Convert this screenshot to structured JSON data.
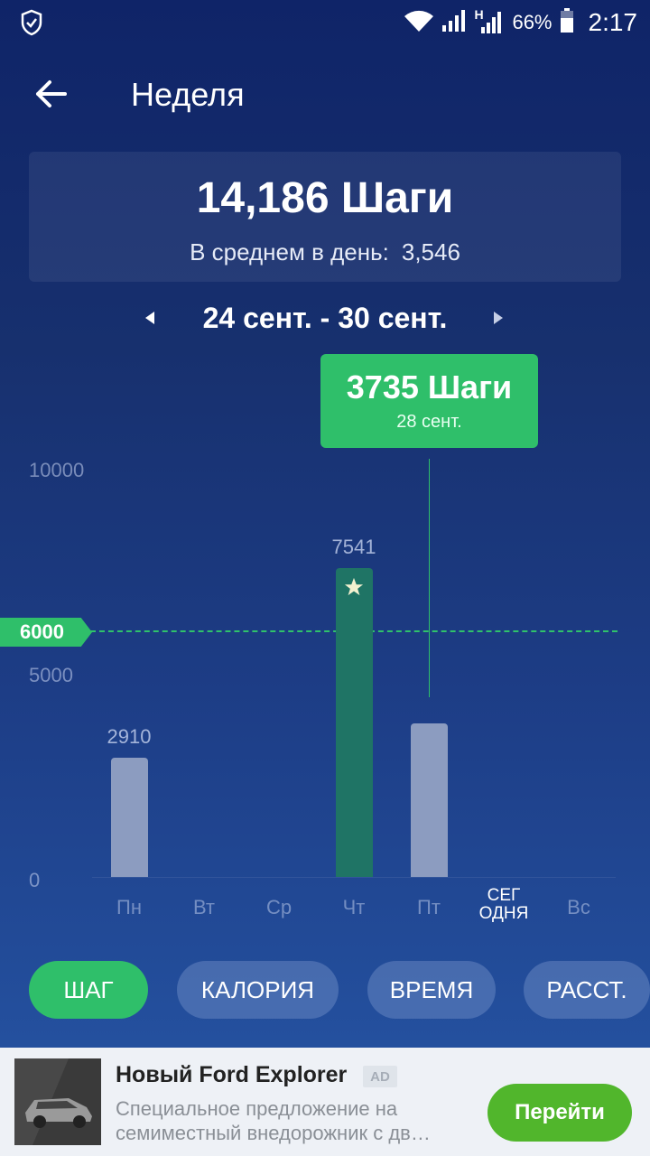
{
  "status_bar": {
    "network_type": "H",
    "battery": "66%",
    "time": "2:17"
  },
  "header": {
    "title": "Неделя"
  },
  "summary": {
    "total": "14,186 Шаги",
    "avg_label": "В среднем в день:",
    "avg_value": "3,546"
  },
  "week": {
    "range": "24 сент. - 30 сент."
  },
  "chart_data": {
    "type": "bar",
    "categories": [
      "Пн",
      "Вт",
      "Ср",
      "Чт",
      "Пт",
      "СЕГ ОДНЯ",
      "Вс"
    ],
    "values": [
      2910,
      0,
      0,
      7541,
      3735,
      0,
      0
    ],
    "value_labels": [
      "2910",
      "",
      "",
      "7541",
      "",
      "",
      ""
    ],
    "y_ticks": [
      "10000",
      "5000",
      "0"
    ],
    "ylim": [
      0,
      10000
    ],
    "goal": 6000,
    "goal_label": "6000",
    "highlight_index": 3,
    "selected_index": 4,
    "tooltip": {
      "title": "3735 Шаги",
      "date": "28 сент."
    },
    "colors": {
      "bar": "#8c9cc0",
      "highlight_bar": "#1f7465",
      "goal": "#2fbf6a"
    }
  },
  "tabs": [
    {
      "label": "ШАГ",
      "active": true
    },
    {
      "label": "КАЛОРИЯ",
      "active": false
    },
    {
      "label": "ВРЕМЯ",
      "active": false
    },
    {
      "label": "РАССТ.",
      "active": false
    }
  ],
  "ad": {
    "title": "Новый Ford Explorer",
    "badge": "AD",
    "description_line1": "Специальное предложение на",
    "description_line2": "семиместный внедорожник с дв…",
    "cta": "Перейти"
  }
}
